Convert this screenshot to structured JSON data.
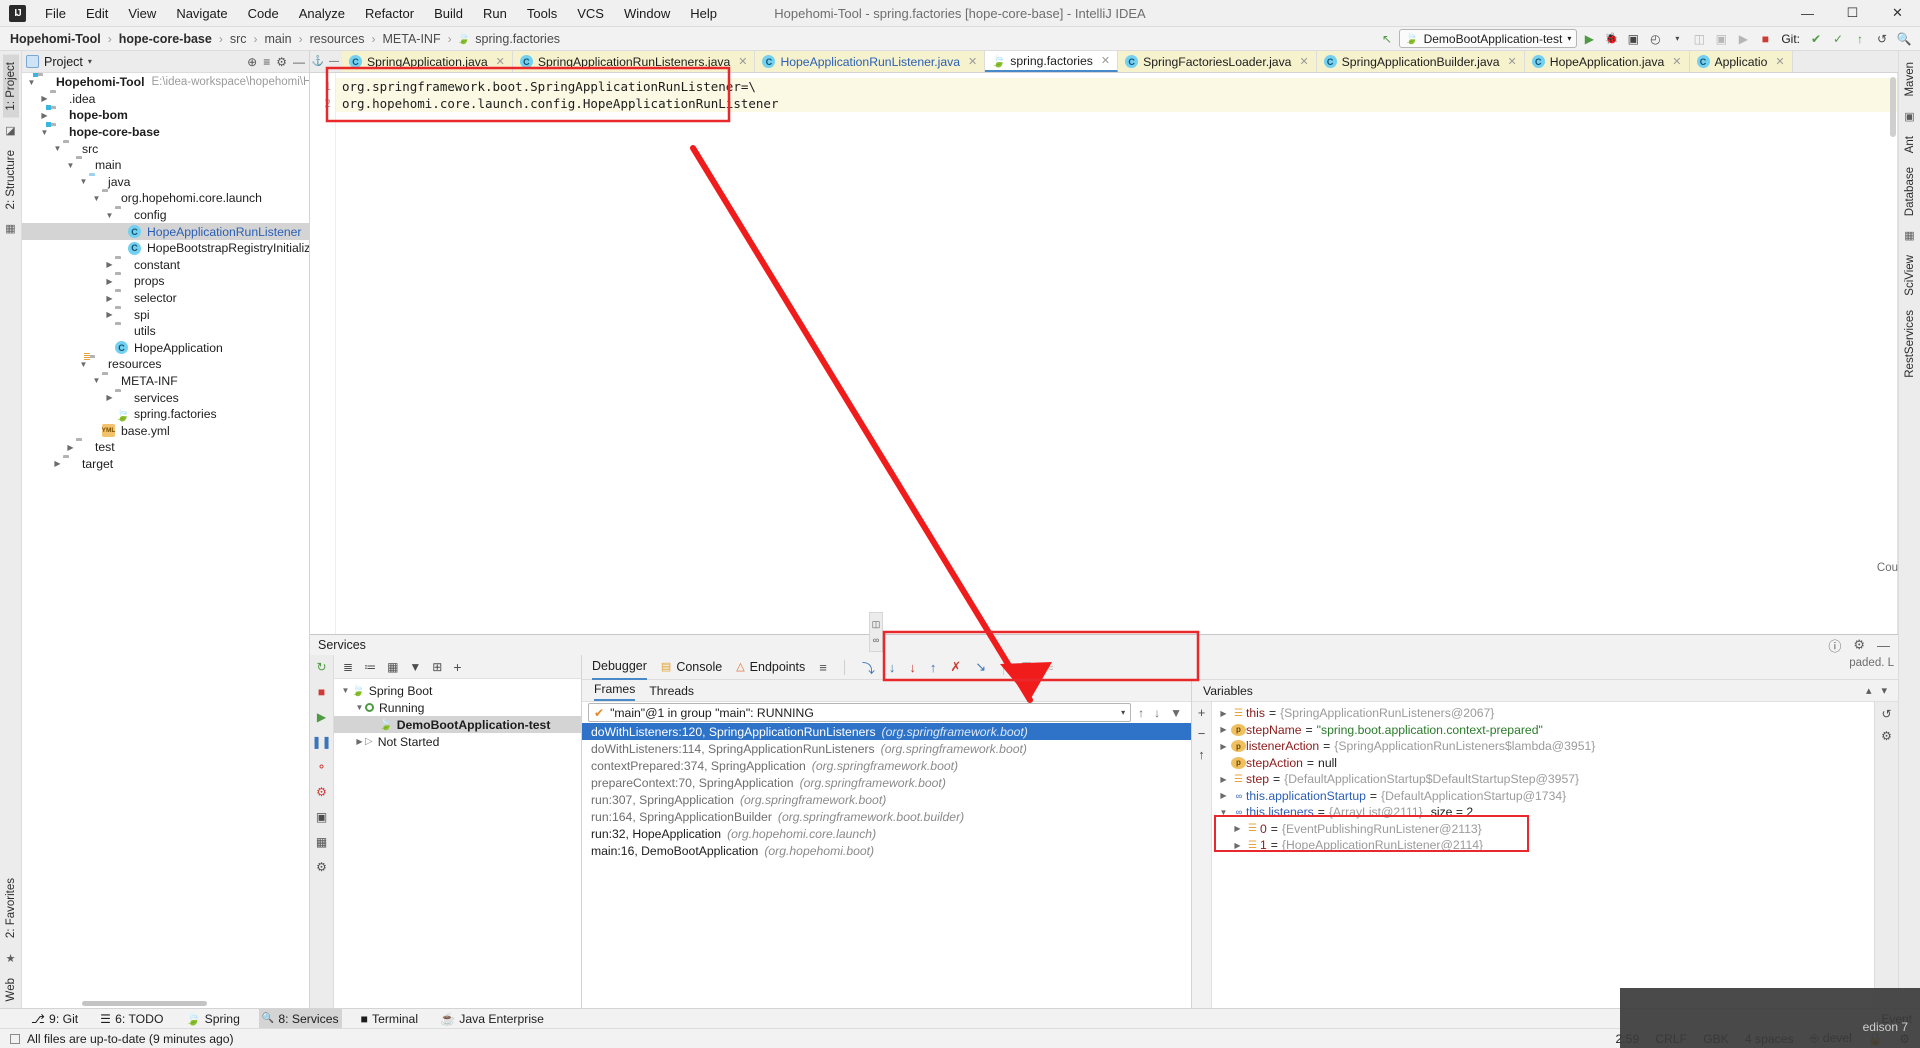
{
  "window": {
    "title": "Hopehomi-Tool - spring.factories [hope-core-base] - IntelliJ IDEA",
    "logo": "IJ",
    "minimize": "—",
    "maximize": "☐",
    "close": "✕"
  },
  "menu": [
    "File",
    "Edit",
    "View",
    "Navigate",
    "Code",
    "Analyze",
    "Refactor",
    "Build",
    "Run",
    "Tools",
    "VCS",
    "Window",
    "Help"
  ],
  "breadcrumb": {
    "items": [
      "Hopehomi-Tool",
      "hope-core-base",
      "src",
      "main",
      "resources",
      "META-INF",
      "spring.factories"
    ],
    "separator": "›"
  },
  "toolbar": {
    "back_icon": "↖",
    "run_config": "DemoBootApplication-test",
    "run_config_caret": "▾",
    "run_icon": "▶",
    "debug_icon": "🐞",
    "run_coverage_icon": "▣",
    "profiler_icon": "◴",
    "profiler_caret": "▾",
    "stop_icon": "■",
    "git_label": "Git:",
    "git_update_icon": "✔",
    "git_commit_icon": "✓",
    "git_push_icon": "↑",
    "git_history_icon": "↺",
    "search_icon": "🔍"
  },
  "left_strip": {
    "project_tab": "1: Project",
    "structure_tab": "2: Structure",
    "favorites_tab": "2: Favorites",
    "web_tab": "Web",
    "git_icon": "◪",
    "struct_icon": "▦",
    "star_icon": "★"
  },
  "right_strip": {
    "maven_tab": "Maven",
    "ant_tab": "Ant",
    "database_tab": "Database",
    "sciview_tab": "SciView",
    "rest_tab": "RestServices"
  },
  "project_panel": {
    "title": "Project",
    "caret": "▾",
    "locate_icon": "⊕",
    "collapse_icon": "≡",
    "settings_icon": "⚙",
    "hide_icon": "—",
    "tree": [
      {
        "depth": 0,
        "arrow": "▼",
        "icon": "module",
        "label": "Hopehomi-Tool",
        "bold": true,
        "path": "E:\\idea-workspace\\hopehomi\\Hope"
      },
      {
        "depth": 1,
        "arrow": "▶",
        "icon": "folder",
        "label": ".idea"
      },
      {
        "depth": 1,
        "arrow": "▶",
        "icon": "module",
        "label": "hope-bom",
        "bold": true
      },
      {
        "depth": 1,
        "arrow": "▼",
        "icon": "module",
        "label": "hope-core-base",
        "bold": true
      },
      {
        "depth": 2,
        "arrow": "▼",
        "icon": "folder",
        "label": "src"
      },
      {
        "depth": 3,
        "arrow": "▼",
        "icon": "folder",
        "label": "main"
      },
      {
        "depth": 4,
        "arrow": "▼",
        "icon": "folder-blue",
        "label": "java"
      },
      {
        "depth": 5,
        "arrow": "▼",
        "icon": "package",
        "label": "org.hopehomi.core.launch"
      },
      {
        "depth": 6,
        "arrow": "▼",
        "icon": "package",
        "label": "config"
      },
      {
        "depth": 7,
        "arrow": "",
        "icon": "class",
        "label": "HopeApplicationRunListener",
        "selected": true,
        "blue": true
      },
      {
        "depth": 7,
        "arrow": "",
        "icon": "class",
        "label": "HopeBootstrapRegistryInitializer"
      },
      {
        "depth": 6,
        "arrow": "▶",
        "icon": "package",
        "label": "constant"
      },
      {
        "depth": 6,
        "arrow": "▶",
        "icon": "package",
        "label": "props"
      },
      {
        "depth": 6,
        "arrow": "▶",
        "icon": "package",
        "label": "selector"
      },
      {
        "depth": 6,
        "arrow": "▶",
        "icon": "package",
        "label": "spi"
      },
      {
        "depth": 6,
        "arrow": "",
        "icon": "package",
        "label": "utils"
      },
      {
        "depth": 6,
        "arrow": "",
        "icon": "class",
        "label": "HopeApplication"
      },
      {
        "depth": 4,
        "arrow": "▼",
        "icon": "resources",
        "label": "resources"
      },
      {
        "depth": 5,
        "arrow": "▼",
        "icon": "folder",
        "label": "META-INF"
      },
      {
        "depth": 6,
        "arrow": "▶",
        "icon": "folder",
        "label": "services"
      },
      {
        "depth": 6,
        "arrow": "",
        "icon": "spring",
        "label": "spring.factories"
      },
      {
        "depth": 5,
        "arrow": "",
        "icon": "yml",
        "label": "base.yml"
      },
      {
        "depth": 3,
        "arrow": "▶",
        "icon": "folder",
        "label": "test"
      },
      {
        "depth": 2,
        "arrow": "▶",
        "icon": "folder",
        "label": "target"
      }
    ]
  },
  "editor": {
    "tabs": [
      {
        "label": "SpringApplication.java",
        "icon": "class-green",
        "active": false
      },
      {
        "label": "SpringApplicationRunListeners.java",
        "icon": "class",
        "active": false
      },
      {
        "label": "HopeApplicationRunListener.java",
        "icon": "class",
        "active": false,
        "highlight": true
      },
      {
        "label": "spring.factories",
        "icon": "spring",
        "active": true
      },
      {
        "label": "SpringFactoriesLoader.java",
        "icon": "class",
        "active": false
      },
      {
        "label": "SpringApplicationBuilder.java",
        "icon": "class",
        "active": false
      },
      {
        "label": "HopeApplication.java",
        "icon": "class",
        "active": false
      },
      {
        "label": "Applicatio",
        "icon": "class",
        "active": false
      }
    ],
    "tab_close": "✕",
    "pin_icon": "⚓",
    "minimize_icon": "—",
    "close_icon": "✕",
    "gutter": [
      "1",
      "2"
    ],
    "lines": [
      "org.springframework.boot.SpringApplicationRunListener=\\",
      "org.hopehomi.core.launch.config.HopeApplicationRunListener"
    ]
  },
  "services": {
    "title": "Services",
    "header_icons": {
      "help": "⚙",
      "settings": "⚙",
      "hide": "—",
      "gear": "⚙"
    },
    "toolbar": {
      "expand_icon": "≣",
      "collapse_icon": "≔",
      "group_icon": "▦",
      "filter_icon": "▼",
      "layout_icon": "⊞",
      "add_icon": "+"
    },
    "sidebar_icons": {
      "rerun": "↺",
      "stop": "■",
      "resume": "▶▌",
      "pause": "❚❚",
      "mute": "⊘",
      "step": "⤵",
      "camera": "▣",
      "layout": "▦",
      "settings": "⚙"
    },
    "tree": [
      {
        "depth": 0,
        "arrow": "▼",
        "icon": "spring",
        "label": "Spring Boot"
      },
      {
        "depth": 1,
        "arrow": "▼",
        "icon": "running",
        "label": "Running"
      },
      {
        "depth": 2,
        "arrow": "",
        "icon": "app",
        "label": "DemoBootApplication-test",
        "selected": true
      },
      {
        "depth": 1,
        "arrow": "▶",
        "icon": "notstarted",
        "label": "Not Started"
      }
    ]
  },
  "debugger": {
    "tabs": [
      {
        "label": "Debugger",
        "active": true
      },
      {
        "label": "Console",
        "active": false,
        "icon": "console"
      },
      {
        "label": "Endpoints",
        "active": false,
        "icon": "endpoints"
      }
    ],
    "actions": {
      "layout_icon": "≡",
      "step_over": "⤵",
      "step_into": "↓",
      "force_step_into": "↓",
      "step_out": "↑",
      "drop_frame": "✗",
      "run_to_cursor": "↘",
      "evaluate": "⊞",
      "mute": "≈"
    },
    "frames_tabs": [
      {
        "label": "Frames",
        "active": true
      },
      {
        "label": "Threads",
        "active": false
      }
    ],
    "thread_selector": {
      "value": "\"main\"@1 in group \"main\": RUNNING",
      "check_icon": "✔",
      "caret": "▾",
      "up_icon": "↑",
      "down_icon": "↓",
      "filter_icon": "▼"
    },
    "frames": [
      {
        "name": "doWithListeners:120, SpringApplicationRunListeners",
        "pkg": "(org.springframework.boot)",
        "selected": true
      },
      {
        "name": "doWithListeners:114, SpringApplicationRunListeners",
        "pkg": "(org.springframework.boot)",
        "gray": true
      },
      {
        "name": "contextPrepared:374, SpringApplication",
        "pkg": "(org.springframework.boot)",
        "gray": true
      },
      {
        "name": "prepareContext:70, SpringApplication",
        "pkg": "(org.springframework.boot)",
        "gray": true
      },
      {
        "name": "run:307, SpringApplication",
        "pkg": "(org.springframework.boot)",
        "gray": true
      },
      {
        "name": "run:164, SpringApplicationBuilder",
        "pkg": "(org.springframework.boot.builder)",
        "gray": true
      },
      {
        "name": "run:32, HopeApplication",
        "pkg": "(org.hopehomi.core.launch)"
      },
      {
        "name": "main:16, DemoBootApplication",
        "pkg": "(org.hopehomi.boot)"
      }
    ],
    "variables_title": "Variables",
    "variables_gutter": {
      "add": "+",
      "remove": "−",
      "up": "↑"
    },
    "variables": [
      {
        "depth": 0,
        "arrow": "▶",
        "icon": "list",
        "name": "this",
        "eq": "=",
        "value": "{SpringApplicationRunListeners@2067}"
      },
      {
        "depth": 0,
        "arrow": "▶",
        "icon": "p",
        "name": "stepName",
        "eq": "=",
        "value": "\"spring.boot.application.context-prepared\"",
        "value_kind": "string"
      },
      {
        "depth": 0,
        "arrow": "▶",
        "icon": "p",
        "name": "listenerAction",
        "eq": "=",
        "value": "{SpringApplicationRunListeners$lambda@3951}"
      },
      {
        "depth": 0,
        "arrow": "",
        "icon": "p",
        "name": "stepAction",
        "eq": "=",
        "value": "null",
        "value_kind": "kw"
      },
      {
        "depth": 0,
        "arrow": "▶",
        "icon": "list",
        "name": "step",
        "eq": "=",
        "value": "{DefaultApplicationStartup$DefaultStartupStep@3957}"
      },
      {
        "depth": 0,
        "arrow": "▶",
        "icon": "oo",
        "name": "this.applicationStartup",
        "eq": "=",
        "value": "{DefaultApplicationStartup@1734}",
        "name_kind": "blue"
      },
      {
        "depth": 0,
        "arrow": "▼",
        "icon": "oo",
        "name": "this.listeners",
        "eq": "=",
        "value": "{ArrayList@2111}",
        "size": "size = 2",
        "name_kind": "blue"
      },
      {
        "depth": 1,
        "arrow": "▶",
        "icon": "list",
        "name": "0",
        "eq": "=",
        "value": "{EventPublishingRunListener@2113}"
      },
      {
        "depth": 1,
        "arrow": "▶",
        "icon": "list",
        "name": "1",
        "eq": "=",
        "value": "{HopeApplicationRunListener@2114}",
        "highlight": true
      }
    ],
    "loaded_note": "paded. L",
    "counter_note": "Cou"
  },
  "bottom_tabs": [
    {
      "label": "9: Git",
      "icon": "⎇"
    },
    {
      "label": "6: TODO",
      "icon": "☰"
    },
    {
      "label": "Spring",
      "icon": "🍃"
    },
    {
      "label": "8: Services",
      "icon": "🔍",
      "selected": true
    },
    {
      "label": "Terminal",
      "icon": "■"
    },
    {
      "label": "Java Enterprise",
      "icon": "☕"
    }
  ],
  "bottom_right": {
    "event_log": "Event",
    "icon": "⚙"
  },
  "status_bar": {
    "message": "All files are up-to-date (9 minutes ago)",
    "caret_pos": "2:59",
    "line_sep": "CRLF",
    "encoding": "GBK",
    "indent": "4 spaces",
    "branch": "devel",
    "lock_icon": "🔒",
    "gear_icon": "⚙"
  },
  "watermark": "edison 7",
  "annotations": {
    "code_box_color": "#e8282a",
    "vars_box_color": "#e8282a",
    "arrow_color": "#f01c1c"
  }
}
